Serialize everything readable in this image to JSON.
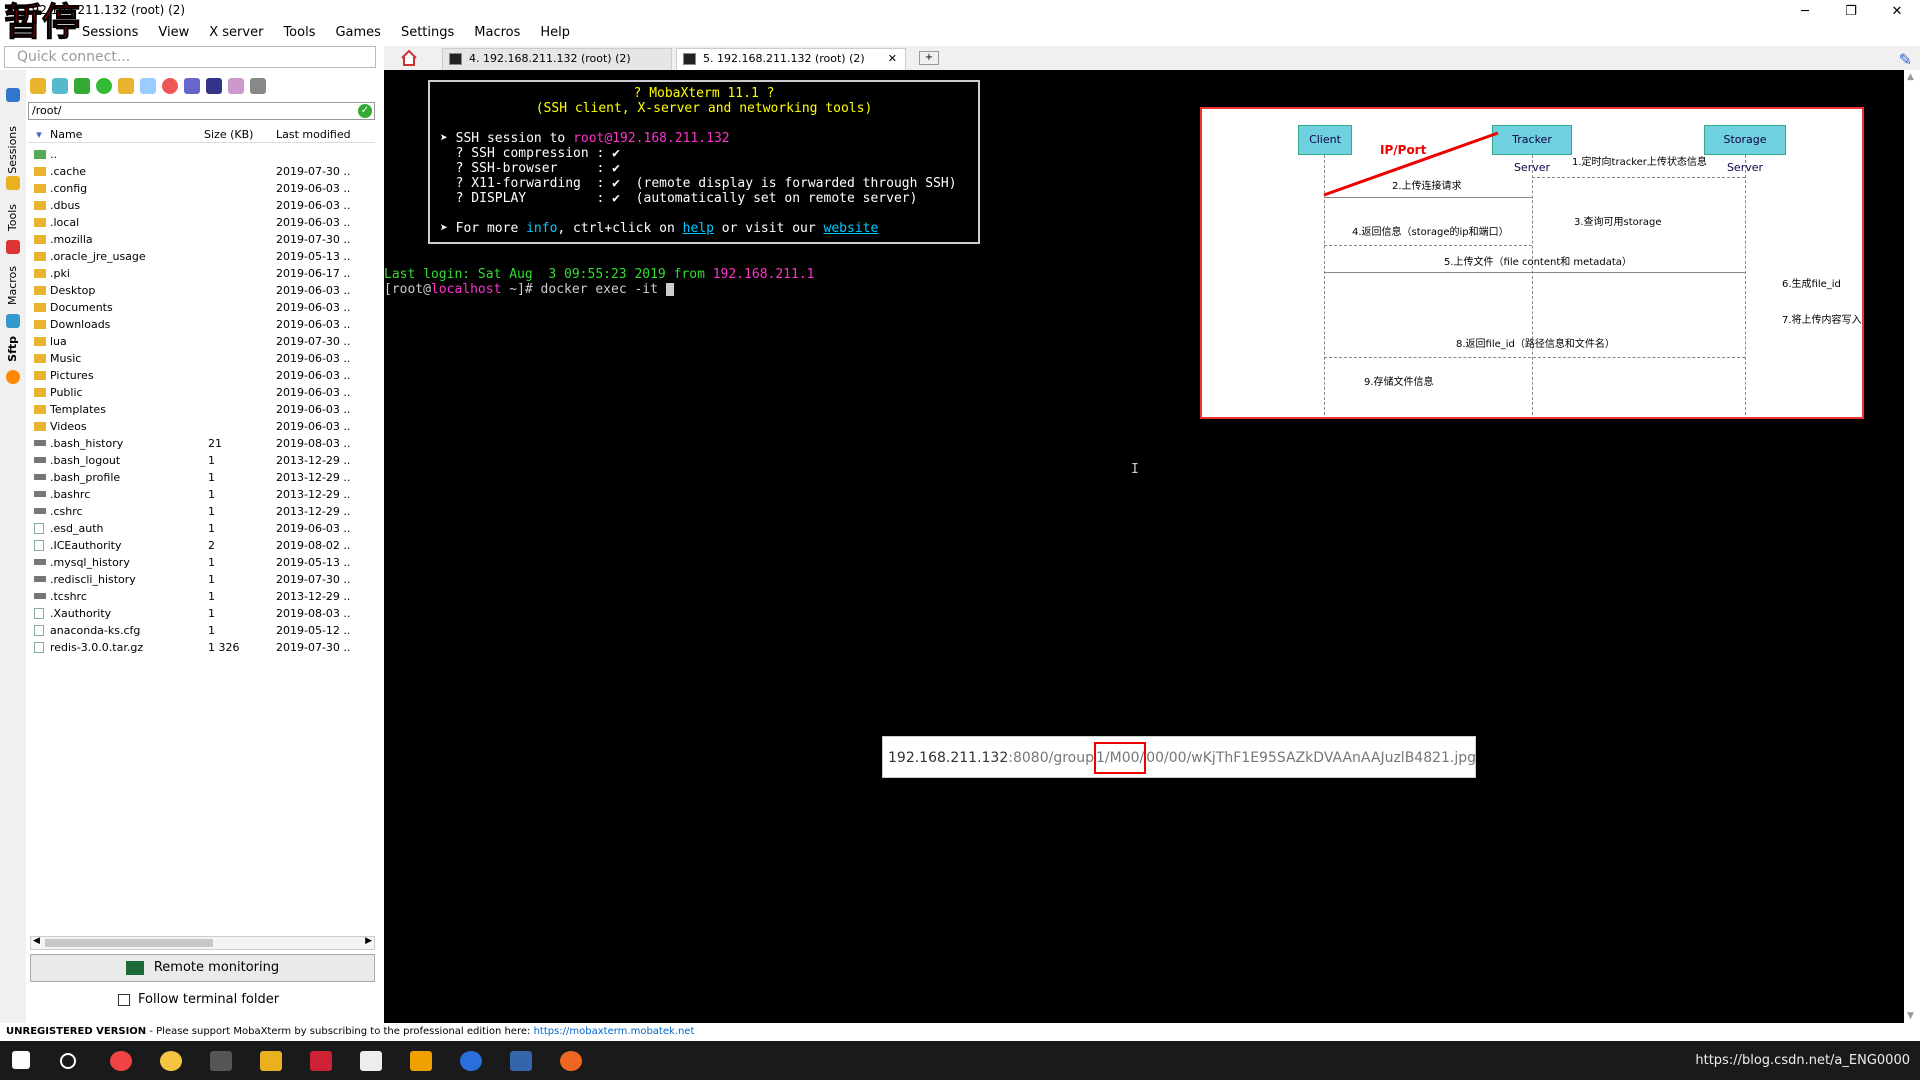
{
  "window": {
    "title": "192.168.211.132 (root) (2)",
    "pause_label": "暂停",
    "btn_min": "─",
    "btn_max": "❐",
    "btn_close": "✕"
  },
  "menu": [
    "Sessions",
    "View",
    "X server",
    "Tools",
    "Games",
    "Settings",
    "Macros",
    "Help"
  ],
  "quick_connect": {
    "placeholder": "Quick connect..."
  },
  "tabs": [
    {
      "label": "4. 192.168.211.132 (root) (2)"
    },
    {
      "label": "5. 192.168.211.132 (root) (2)",
      "close": "✕"
    }
  ],
  "side_tabs": [
    "Sessions",
    "Tools",
    "Macros",
    "Sftp"
  ],
  "file_panel": {
    "path": "/root/",
    "columns": [
      "Name",
      "Size (KB)",
      "Last modified"
    ],
    "files": [
      {
        "name": "..",
        "size": "",
        "modified": "",
        "type": "up"
      },
      {
        "name": ".cache",
        "size": "",
        "modified": "2019-07-30 ..",
        "type": "folder"
      },
      {
        "name": ".config",
        "size": "",
        "modified": "2019-06-03 ..",
        "type": "folder"
      },
      {
        "name": ".dbus",
        "size": "",
        "modified": "2019-06-03 ..",
        "type": "folder"
      },
      {
        "name": ".local",
        "size": "",
        "modified": "2019-06-03 ..",
        "type": "folder"
      },
      {
        "name": ".mozilla",
        "size": "",
        "modified": "2019-07-30 ..",
        "type": "folder"
      },
      {
        "name": ".oracle_jre_usage",
        "size": "",
        "modified": "2019-05-13 ..",
        "type": "folder"
      },
      {
        "name": ".pki",
        "size": "",
        "modified": "2019-06-17 ..",
        "type": "folder"
      },
      {
        "name": "Desktop",
        "size": "",
        "modified": "2019-06-03 ..",
        "type": "folder"
      },
      {
        "name": "Documents",
        "size": "",
        "modified": "2019-06-03 ..",
        "type": "folder"
      },
      {
        "name": "Downloads",
        "size": "",
        "modified": "2019-06-03 ..",
        "type": "folder"
      },
      {
        "name": "lua",
        "size": "",
        "modified": "2019-07-30 ..",
        "type": "folder"
      },
      {
        "name": "Music",
        "size": "",
        "modified": "2019-06-03 ..",
        "type": "folder"
      },
      {
        "name": "Pictures",
        "size": "",
        "modified": "2019-06-03 ..",
        "type": "folder"
      },
      {
        "name": "Public",
        "size": "",
        "modified": "2019-06-03 ..",
        "type": "folder"
      },
      {
        "name": "Templates",
        "size": "",
        "modified": "2019-06-03 ..",
        "type": "folder"
      },
      {
        "name": "Videos",
        "size": "",
        "modified": "2019-06-03 ..",
        "type": "folder"
      },
      {
        "name": ".bash_history",
        "size": "21",
        "modified": "2019-08-03 ..",
        "type": "file"
      },
      {
        "name": ".bash_logout",
        "size": "1",
        "modified": "2013-12-29 ..",
        "type": "file"
      },
      {
        "name": ".bash_profile",
        "size": "1",
        "modified": "2013-12-29 ..",
        "type": "file"
      },
      {
        "name": ".bashrc",
        "size": "1",
        "modified": "2013-12-29 ..",
        "type": "file"
      },
      {
        "name": ".cshrc",
        "size": "1",
        "modified": "2013-12-29 ..",
        "type": "file"
      },
      {
        "name": ".esd_auth",
        "size": "1",
        "modified": "2019-06-03 ..",
        "type": "doc"
      },
      {
        "name": ".ICEauthority",
        "size": "2",
        "modified": "2019-08-02 ..",
        "type": "doc"
      },
      {
        "name": ".mysql_history",
        "size": "1",
        "modified": "2019-05-13 ..",
        "type": "file"
      },
      {
        "name": ".rediscli_history",
        "size": "1",
        "modified": "2019-07-30 ..",
        "type": "file"
      },
      {
        "name": ".tcshrc",
        "size": "1",
        "modified": "2013-12-29 ..",
        "type": "file"
      },
      {
        "name": ".Xauthority",
        "size": "1",
        "modified": "2019-08-03 ..",
        "type": "doc"
      },
      {
        "name": "anaconda-ks.cfg",
        "size": "1",
        "modified": "2019-05-12 ..",
        "type": "doc"
      },
      {
        "name": "redis-3.0.0.tar.gz",
        "size": "1 326",
        "modified": "2019-07-30 ..",
        "type": "doc"
      }
    ],
    "remote_monitoring": "Remote monitoring",
    "follow_terminal": "Follow terminal folder"
  },
  "terminal": {
    "banner_title": "? MobaXterm 11.1 ?",
    "banner_sub": "(SSH client, X-server and networking tools)",
    "ssh_prefix": "➤ SSH session to ",
    "ssh_user": "root",
    "ssh_host": "@192.168.211.132",
    "features": [
      "  ? SSH compression : ✔",
      "  ? SSH-browser     : ✔",
      "  ? X11-forwarding  : ✔  (remote display is forwarded through SSH)",
      "  ? DISPLAY         : ✔  (automatically set on remote server)"
    ],
    "more_a": "➤ For more ",
    "more_info": "info",
    "more_b": ", ctrl+click on ",
    "more_help": "help",
    "more_c": " or visit our ",
    "more_site": "website",
    "last_login_a": "Last login: Sat Aug  3 09:55:23 2019 from ",
    "last_login_ip": "192.168.211.1",
    "prompt_a": "[root@",
    "prompt_host": "localhost",
    "prompt_b": " ~]# docker exec -it ",
    "ibeam": "I"
  },
  "diagram": {
    "client": "Client",
    "tracker": "Tracker Server",
    "storage": "Storage Server",
    "ipport": "IP/Port",
    "s1": "1.定时向tracker上传状态信息",
    "s2": "2.上传连接请求",
    "s3": "3.查询可用storage",
    "s4": "4.返回信息（storage的ip和端口）",
    "s5": "5.上传文件（file content和 metadata）",
    "s6": "6.生成file_id",
    "s7": "7.将上传内容写入",
    "s8": "8.返回file_id（路径信息和文件名）",
    "s9": "9.存储文件信息"
  },
  "url_overlay": {
    "a": "192.168.211.132",
    "b": ":8080/group",
    "c": "1",
    "d": "/M00/",
    "e": "00/00/wKjThF1E95SAZkDVAAnAAJuzlB4821.jpg"
  },
  "status": {
    "label": "UNREGISTERED VERSION",
    "text": "  -  Please support MobaXterm by subscribing to the professional edition here:  ",
    "link": "https://mobaxterm.mobatek.net"
  },
  "taskbar": {
    "tray": "https://blog.csdn.net/a_ENG0000"
  },
  "colors": {
    "terminal_bg": "#000000",
    "accent_magenta": "#ff33cc",
    "link_cyan": "#00ccff"
  }
}
